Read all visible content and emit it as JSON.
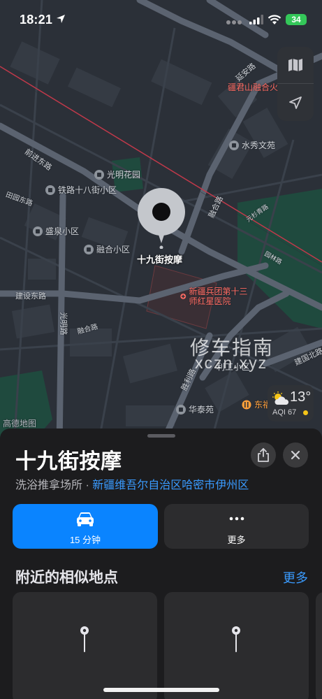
{
  "status_bar": {
    "time": "18:21",
    "battery": "34"
  },
  "map": {
    "selected_place_label": "十九街按摩",
    "pois": [
      {
        "id": "junshan",
        "label": "疆君山融合火",
        "kind": "red"
      },
      {
        "id": "shuixiu",
        "label": "水秀文苑",
        "kind": "gray"
      },
      {
        "id": "guangming",
        "label": "光明花园",
        "kind": "gray"
      },
      {
        "id": "tielu",
        "label": "铁路十八街小区",
        "kind": "gray"
      },
      {
        "id": "shengquan",
        "label": "盛泉小区",
        "kind": "gray"
      },
      {
        "id": "ronghe",
        "label": "融合小区",
        "kind": "gray"
      },
      {
        "id": "hospital",
        "label": "新疆兵团第十三师红星医院",
        "kind": "red"
      },
      {
        "id": "huatai",
        "label": "华泰苑",
        "kind": "gray"
      },
      {
        "id": "dongfu",
        "label": "东福",
        "kind": "orange"
      },
      {
        "id": "ligong",
        "label": "利工小区",
        "kind": "gray"
      }
    ],
    "roads": {
      "yanan": "延安路",
      "qianjin": "前进东路",
      "tianyuan": "田园东路",
      "jianshe": "建设东路",
      "guangming_rd": "光明路",
      "ronghe_rd": "融合路",
      "shengli": "胜利路",
      "jianguo": "建国北路",
      "yuanlin": "园林路",
      "yuanshan": "元杉青路",
      "ronghe_road2": "融合路"
    },
    "watermark_line1": "修车指南",
    "watermark_line2": "xczn.xyz",
    "attribution": "高德地图",
    "weather": {
      "temp": "13°",
      "aqi": "AQI 67",
      "aqi_color": "#f5c518"
    }
  },
  "sheet": {
    "title": "十九街按摩",
    "category": "洗浴推拿场所",
    "separator": " · ",
    "location": "新疆维吾尔自治区哈密市伊州区",
    "actions": {
      "drive_label": "15 分钟",
      "more_label": "更多"
    },
    "similar_title": "附近的相似地点",
    "similar_more": "更多"
  },
  "colors": {
    "accent": "#0a84ff",
    "link": "#3a9bff",
    "poi_red": "#ff6b62",
    "battery": "#34c759"
  }
}
